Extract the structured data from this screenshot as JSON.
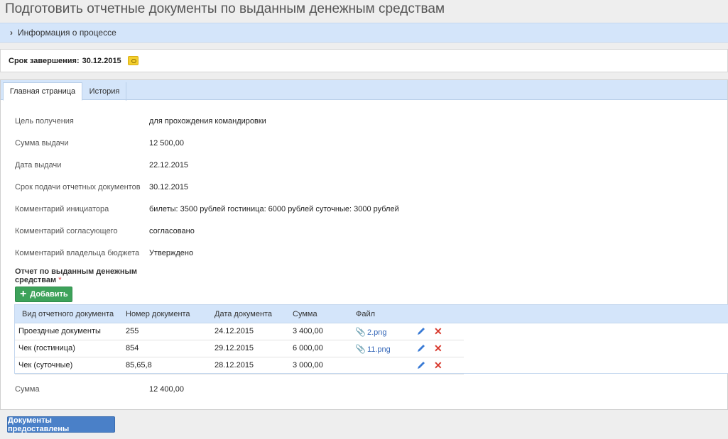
{
  "page_title": "Подготовить отчетные документы по выданным денежным средствам",
  "process_info": {
    "label": "Информация о процессе",
    "icon": "chevron-right-icon"
  },
  "deadline": {
    "label": "Срок завершения:",
    "value": "30.12.2015",
    "icon": "calendar-icon"
  },
  "tabs": [
    {
      "label": "Главная страница",
      "active": true
    },
    {
      "label": "История",
      "active": false
    }
  ],
  "fields": [
    {
      "label": "Цель получения",
      "value": "для прохождения командировки"
    },
    {
      "label": "Сумма выдачи",
      "value": "12 500,00"
    },
    {
      "label": "Дата выдачи",
      "value": "22.12.2015"
    },
    {
      "label": "Срок подачи отчетных документов",
      "value": "30.12.2015"
    },
    {
      "label": "Комментарий инициатора",
      "value": "билеты: 3500 рублей гостиница: 6000 рублей суточные: 3000 рублей"
    },
    {
      "label": "Комментарий согласующего",
      "value": "согласовано"
    },
    {
      "label": "Комментарий владельца бюджета",
      "value": "Утверждено"
    }
  ],
  "report": {
    "label": "Отчет по выданным денежным средствам",
    "required_mark": "*",
    "add_button": "Добавить",
    "columns": [
      "Вид отчетного документа",
      "Номер документа",
      "Дата документа",
      "Сумма",
      "Файл"
    ],
    "rows": [
      {
        "type": "Проездные документы",
        "number": "255",
        "date": "24.12.2015",
        "amount": "3 400,00",
        "file": "2.png"
      },
      {
        "type": "Чек (гостиница)",
        "number": "854",
        "date": "29.12.2015",
        "amount": "6 000,00",
        "file": "11.png"
      },
      {
        "type": "Чек (суточные)",
        "number": "85,65,8",
        "date": "28.12.2015",
        "amount": "3 000,00",
        "file": ""
      }
    ]
  },
  "total": {
    "label": "Сумма",
    "value": "12 400,00"
  },
  "submit_button": "Документы предоставлены",
  "colors": {
    "accent_bar": "#d4e5fa",
    "add_button": "#3da25a",
    "submit_button": "#4a80c8",
    "delete": "#d83a2e"
  }
}
